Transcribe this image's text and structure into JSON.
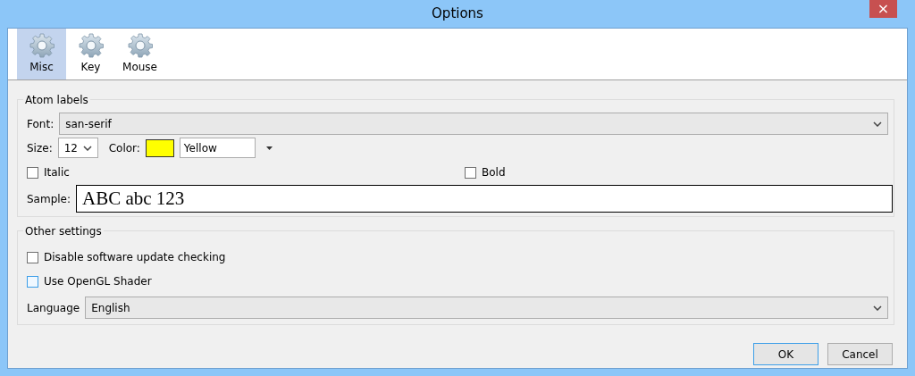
{
  "window": {
    "title": "Options",
    "close_label": "×"
  },
  "tabs": [
    {
      "label": "Misc",
      "selected": true
    },
    {
      "label": "Key",
      "selected": false
    },
    {
      "label": "Mouse",
      "selected": false
    }
  ],
  "atom_labels": {
    "title": "Atom labels",
    "font_label": "Font:",
    "font": "san-serif",
    "size_label": "Size:",
    "size": "12",
    "color_label": "Color:",
    "color": "#ffff00",
    "color_name": "Yellow",
    "italic": {
      "label": "Italic",
      "checked": false
    },
    "bold": {
      "label": "Bold",
      "checked": false
    },
    "sample_label": "Sample:",
    "sample": "ABC abc 123"
  },
  "other_settings": {
    "title": "Other settings",
    "options": [
      {
        "label": "Disable software update checking",
        "checked": false,
        "hovered": false
      },
      {
        "label": "Use OpenGL Shader",
        "checked": false,
        "hovered": true
      }
    ],
    "language_label": "Language",
    "language": "English"
  },
  "buttons": [
    {
      "label": "OK",
      "default": true
    },
    {
      "label": "Cancel",
      "default": false
    }
  ]
}
